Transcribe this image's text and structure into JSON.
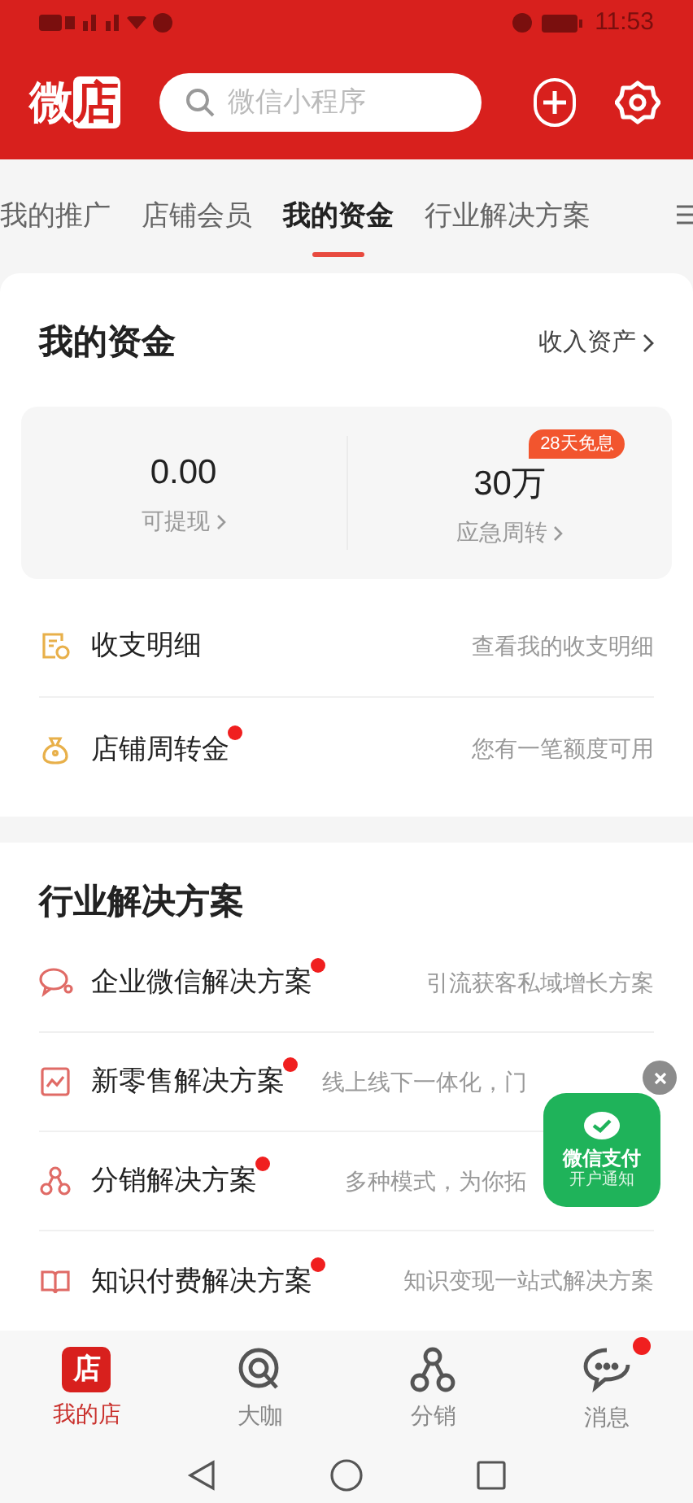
{
  "status_bar": {
    "time": "11:53"
  },
  "header": {
    "logo_left": "微",
    "logo_right": "店",
    "search": {
      "placeholder": "微信小程序"
    }
  },
  "tabs": [
    {
      "label": "我的推广",
      "selected": false
    },
    {
      "label": "店铺会员",
      "selected": false
    },
    {
      "label": "我的资金",
      "selected": true
    },
    {
      "label": "行业解决方案",
      "selected": false
    }
  ],
  "funds": {
    "title": "我的资金",
    "link": "收入资产",
    "stats": [
      {
        "value": "0.00",
        "label": "可提现"
      },
      {
        "value": "30万",
        "label": "应急周转",
        "badge": "28天免息"
      }
    ],
    "rows": [
      {
        "kind": "detail",
        "title": "收支明细",
        "hint": "查看我的收支明细",
        "dot": false
      },
      {
        "kind": "bag",
        "title": "店铺周转金",
        "hint": "您有一笔额度可用",
        "dot": true
      }
    ]
  },
  "solutions": {
    "title": "行业解决方案",
    "rows": [
      {
        "kind": "chat",
        "title": "企业微信解决方案",
        "hint": "引流获客私域增长方案",
        "dot": true
      },
      {
        "kind": "chart",
        "title": "新零售解决方案",
        "hint": "线上线下一体化，门",
        "dot": true
      },
      {
        "kind": "share",
        "title": "分销解决方案",
        "hint": "多种模式，为你拓",
        "dot": true
      },
      {
        "kind": "book",
        "title": "知识付费解决方案",
        "hint": "知识变现一站式解决方案",
        "dot": true
      }
    ]
  },
  "float_badge": {
    "title": "微信支付",
    "subtitle": "开户通知"
  },
  "bottom_nav": [
    {
      "kind": "shop",
      "label": "我的店",
      "glyph": "店",
      "selected": true,
      "dot": false
    },
    {
      "kind": "q",
      "label": "大咖",
      "selected": false,
      "dot": false
    },
    {
      "kind": "share",
      "label": "分销",
      "selected": false,
      "dot": false
    },
    {
      "kind": "chat",
      "label": "消息",
      "selected": false,
      "dot": true
    }
  ]
}
